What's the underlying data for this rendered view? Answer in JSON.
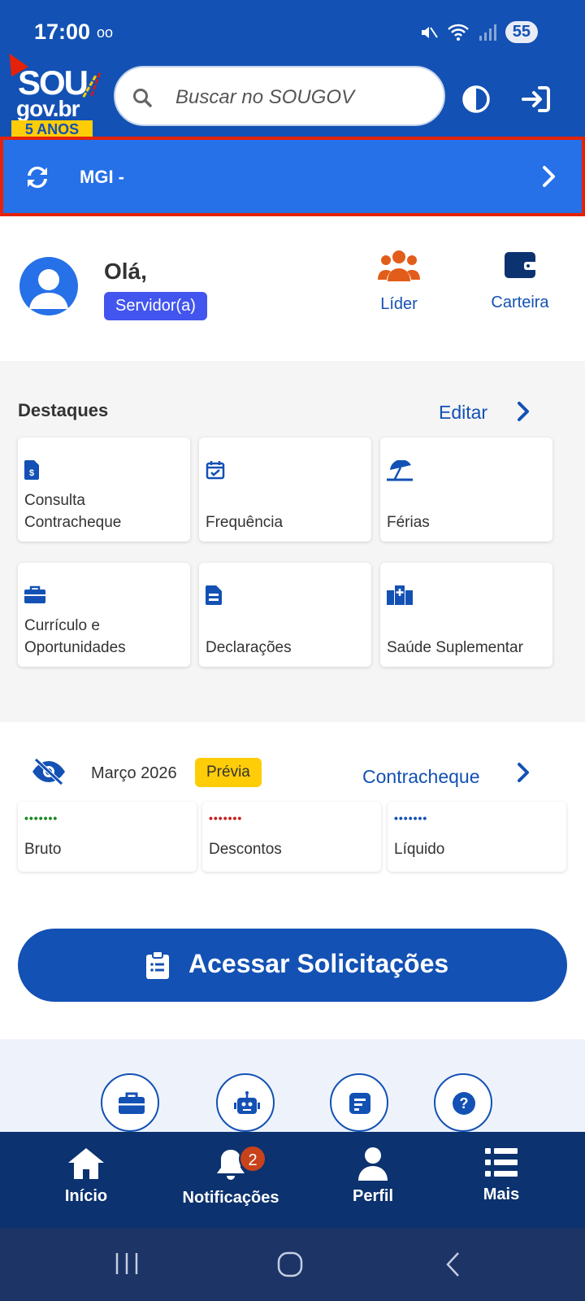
{
  "status_bar": {
    "time": "17:00",
    "voicemail": "oo",
    "battery": "55"
  },
  "header": {
    "logo": {
      "line1": "SOU",
      "line2": "gov.br",
      "badge": "5 ANOS"
    },
    "search": {
      "placeholder": "Buscar no SOUGOV"
    }
  },
  "org_banner": {
    "label": "MGI -"
  },
  "profile": {
    "greeting": "Olá,",
    "role": "Servidor(a)",
    "quick_actions": [
      {
        "label": "Líder",
        "icon": "people-group-icon"
      },
      {
        "label": "Carteira",
        "icon": "wallet-icon"
      }
    ]
  },
  "highlights": {
    "title": "Destaques",
    "edit_label": "Editar",
    "cards": [
      {
        "label": "Consulta Contracheque",
        "icon": "payslip-icon"
      },
      {
        "label": "Frequência",
        "icon": "calendar-check-icon"
      },
      {
        "label": "Férias",
        "icon": "beach-umbrella-icon"
      },
      {
        "label": "Currículo e Oportunidades",
        "icon": "briefcase-icon"
      },
      {
        "label": "Declarações",
        "icon": "document-icon"
      },
      {
        "label": "Saúde Suplementar",
        "icon": "hospital-icon"
      }
    ]
  },
  "payslip": {
    "month": "Março 2026",
    "badge": "Prévia",
    "link": "Contracheque",
    "values": [
      {
        "label": "Bruto",
        "mask": "•••••••",
        "color": "#168821"
      },
      {
        "label": "Descontos",
        "mask": "•••••••",
        "color": "#c81e1e"
      },
      {
        "label": "Líquido",
        "mask": "•••••••",
        "color": "#1351b4"
      }
    ]
  },
  "cta": {
    "label": "Acessar Solicitações"
  },
  "tools": [
    "briefcase-icon",
    "robot-icon",
    "form-icon",
    "help-icon"
  ],
  "bottom_nav": {
    "items": [
      {
        "label": "Início",
        "icon": "home-icon"
      },
      {
        "label": "Notificações",
        "icon": "bell-icon",
        "badge": "2"
      },
      {
        "label": "Perfil",
        "icon": "user-icon"
      },
      {
        "label": "Mais",
        "icon": "list-icon"
      }
    ]
  },
  "colors": {
    "primary": "#1351b4",
    "banner": "#2670e8",
    "highlight_border": "#e52207",
    "nav": "#0c326f",
    "accent": "#ffcd07"
  }
}
